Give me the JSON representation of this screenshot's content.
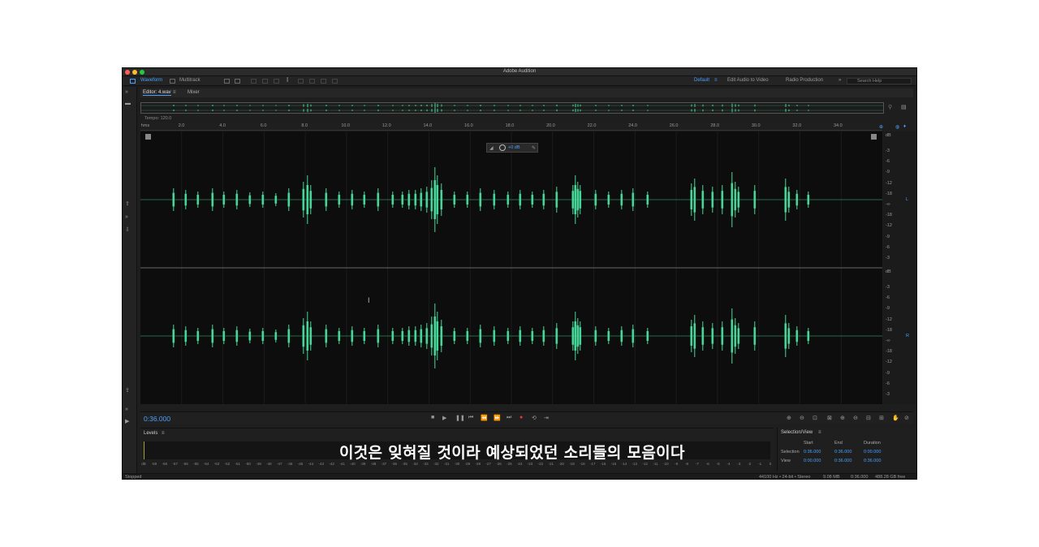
{
  "app": {
    "title": "Adobe Audition",
    "colors": {
      "accent": "#4aa0ff",
      "waveform": "#46d99a",
      "background": "#1e1e1e"
    }
  },
  "toolbar": {
    "waveform_label": "Waveform",
    "multitrack_label": "Multitrack",
    "workspaces": [
      "Default",
      "Edit Audio to Video",
      "Radio Production"
    ],
    "search_placeholder": "Search Help"
  },
  "editor": {
    "tab_label": "Editor: 4.wav",
    "mixer_label": "Mixer",
    "tempo_label": "Tempo: 120.0",
    "ruler_unit": "hms",
    "ruler_ticks": [
      "2.0",
      "4.0",
      "6.0",
      "8.0",
      "10.0",
      "12.0",
      "14.0",
      "16.0",
      "18.0",
      "20.0",
      "22.0",
      "24.0",
      "26.0",
      "28.0",
      "30.0",
      "32.0",
      "34.0"
    ],
    "hud_gain": "+0 dB",
    "db_unit": "dB",
    "db_labels": [
      "-3",
      "-6",
      "-9",
      "-12",
      "-18",
      "-∞",
      "-18",
      "-12",
      "-9",
      "-6",
      "-3"
    ],
    "channels": [
      "L",
      "R"
    ]
  },
  "transport": {
    "timecode": "0:36.000"
  },
  "levels": {
    "title": "Levels",
    "scale": [
      "dB",
      "-59",
      "-58",
      "-57",
      "-56",
      "-55",
      "-54",
      "-53",
      "-52",
      "-51",
      "-50",
      "-49",
      "-48",
      "-47",
      "-46",
      "-45",
      "-44",
      "-43",
      "-42",
      "-41",
      "-40",
      "-39",
      "-38",
      "-37",
      "-36",
      "-35",
      "-34",
      "-33",
      "-32",
      "-31",
      "-30",
      "-29",
      "-28",
      "-27",
      "-26",
      "-25",
      "-24",
      "-23",
      "-22",
      "-21",
      "-20",
      "-19",
      "-18",
      "-17",
      "-16",
      "-15",
      "-14",
      "-13",
      "-12",
      "-11",
      "-10",
      "-9",
      "-8",
      "-7",
      "-6",
      "-5",
      "-4",
      "-3",
      "-2",
      "-1",
      "0"
    ]
  },
  "selection_view": {
    "title": "Selection/View",
    "col_start": "Start",
    "col_end": "End",
    "col_duration": "Duration",
    "row_selection": "Selection",
    "row_view": "View",
    "selection_start": "0:36.000",
    "selection_end": "0:36.000",
    "selection_duration": "0:00.000",
    "view_start": "0:00.000",
    "view_end": "0:36.000",
    "view_duration": "0:36.000"
  },
  "status": {
    "state": "Stopped",
    "format": "44100 Hz • 24-bit • Stereo",
    "size": "9.08 MB",
    "duration": "0:36.000",
    "free": "488.28 GB free"
  },
  "subtitle": "이것은 잊혀질 것이라 예상되었던 소리들의 모음이다"
}
